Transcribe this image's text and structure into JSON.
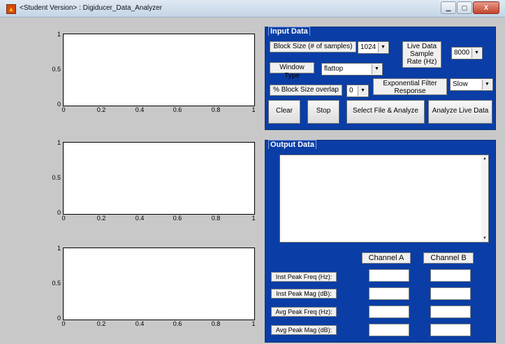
{
  "window": {
    "title": "<Student Version> : Digiducer_Data_Analyzer",
    "icon": "matlab-icon",
    "controls": {
      "minimize": "▁",
      "maximize": "▢",
      "close": "X"
    }
  },
  "axes": [
    {
      "yticks": [
        "1",
        "0.5",
        "0"
      ],
      "xticks": [
        "0",
        "0.2",
        "0.4",
        "0.6",
        "0.8",
        "1"
      ],
      "xlim": [
        0,
        1
      ],
      "ylim": [
        0,
        1
      ]
    },
    {
      "yticks": [
        "1",
        "0.5",
        "0"
      ],
      "xticks": [
        "0",
        "0.2",
        "0.4",
        "0.6",
        "0.8",
        "1"
      ],
      "xlim": [
        0,
        1
      ],
      "ylim": [
        0,
        1
      ]
    },
    {
      "yticks": [
        "1",
        "0.5",
        "0"
      ],
      "xticks": [
        "0",
        "0.2",
        "0.4",
        "0.6",
        "0.8",
        "1"
      ],
      "xlim": [
        0,
        1
      ],
      "ylim": [
        0,
        1
      ]
    }
  ],
  "input": {
    "title": "Input Data",
    "block_size_label": "Block Size (# of samples)",
    "block_size_value": "1024",
    "rate_label": "Live Data Sample Rate (Hz)",
    "rate_value": "8000",
    "window_label": "Window Type",
    "window_value": "flattop",
    "overlap_label": "% Block Size overlap",
    "overlap_value": "0",
    "filter_label": "Exponential Filter Response",
    "filter_value": "Slow",
    "buttons": {
      "clear": "Clear",
      "stop": "Stop",
      "select_file": "Select File & Analyze",
      "analyze_live": "Analyze Live Data"
    }
  },
  "output": {
    "title": "Output Data",
    "scroll_up": "▲",
    "scroll_down": "▼",
    "channel_a": "Channel A",
    "channel_b": "Channel B",
    "rows": {
      "inst_freq": "Inst Peak Freq (Hz):",
      "inst_mag": "Inst Peak Mag (dB):",
      "avg_freq": "Avg Peak Freq (Hz):",
      "avg_mag": "Avg Peak Mag (dB):"
    }
  },
  "colors": {
    "panel": "#0a3ea6",
    "figure_bg": "#c8c8c8"
  }
}
